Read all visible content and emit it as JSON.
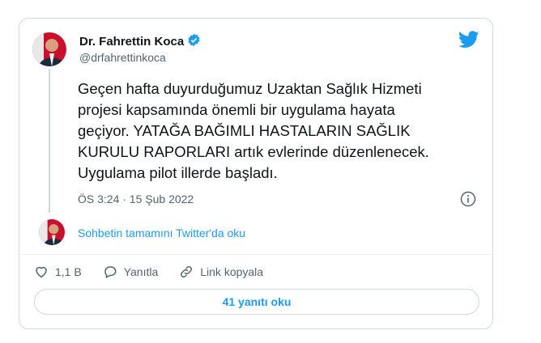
{
  "tweet": {
    "author_name": "Dr. Fahrettin Koca",
    "author_handle": "@drfahrettinkoca",
    "text": "Geçen hafta duyurduğumuz Uzaktan Sağlık Hizmeti\nprojesi kapsamında önemli bir uygulama hayata\ngeçiyor. YATAĞA BAĞIMLI HASTALARIN SAĞLIK\nKURULU RAPORLARI artık evlerinde düzenlenecek.\nUygulama pilot illerde başladı.",
    "timestamp": "ÖS 3:24 · 15 Şub 2022",
    "read_conversation": "Sohbetin tamamını Twitter'da oku"
  },
  "actions": {
    "likes": "1,1 B",
    "reply": "Yanıtla",
    "copy_link": "Link kopyala"
  },
  "replies_button": "41 yanıtı oku",
  "colors": {
    "twitter_blue": "#1d9bf0",
    "text": "#0f1419",
    "muted": "#536471",
    "border": "#cfd9de"
  },
  "icons": [
    "verified-badge-icon",
    "twitter-bird-icon",
    "info-icon",
    "heart-icon",
    "reply-bubble-icon",
    "link-icon"
  ]
}
